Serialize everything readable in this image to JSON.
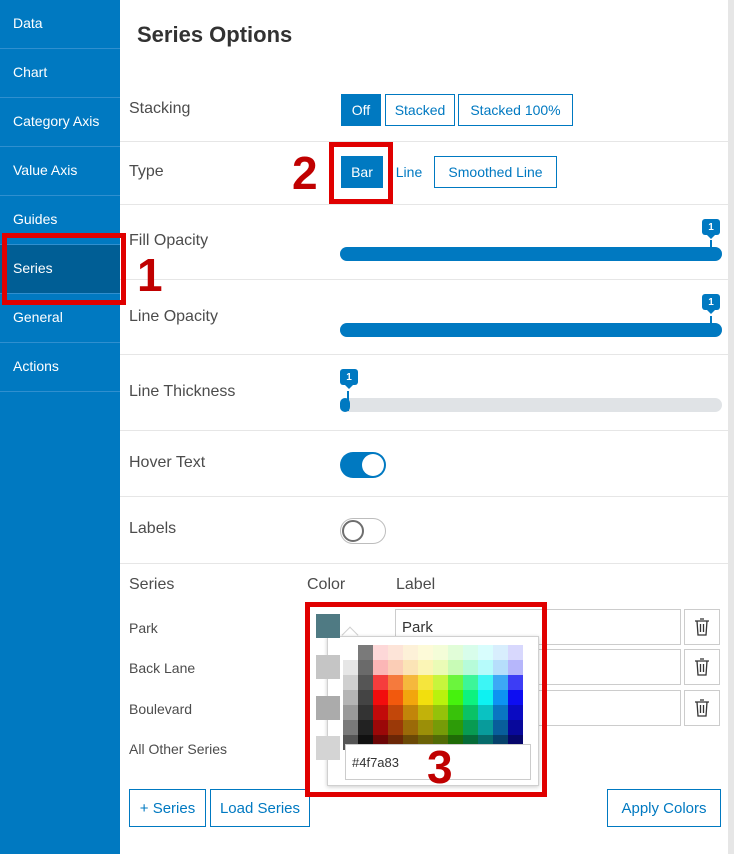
{
  "sidebar": {
    "items": [
      {
        "label": "Data"
      },
      {
        "label": "Chart"
      },
      {
        "label": "Category Axis"
      },
      {
        "label": "Value Axis"
      },
      {
        "label": "Guides"
      },
      {
        "label": "Series"
      },
      {
        "label": "General"
      },
      {
        "label": "Actions"
      }
    ],
    "active": "Series"
  },
  "panel": {
    "title": "Series Options",
    "stacking": {
      "label": "Stacking",
      "options": [
        "Off",
        "Stacked",
        "Stacked 100%"
      ],
      "selected": "Off"
    },
    "type": {
      "label": "Type",
      "options": [
        "Bar",
        "Line",
        "Smoothed Line"
      ],
      "selected": "Bar"
    },
    "fill_opacity": {
      "label": "Fill Opacity",
      "value": "1"
    },
    "line_opacity": {
      "label": "Line Opacity",
      "value": "1"
    },
    "line_thickness": {
      "label": "Line Thickness",
      "value": "1"
    },
    "hover_text": {
      "label": "Hover Text",
      "on": true
    },
    "labels": {
      "label": "Labels",
      "on": false
    }
  },
  "series_table": {
    "headers": {
      "series": "Series",
      "color": "Color",
      "label": "Label"
    },
    "rows": [
      {
        "name": "Park",
        "color": "#4f7a83",
        "label": "Park"
      },
      {
        "name": "Back Lane",
        "color": "#c5c5c5",
        "label": ""
      },
      {
        "name": "Boulevard",
        "color": "#ababab",
        "label": ""
      },
      {
        "name": "All Other Series",
        "color": "#d4d4d4",
        "label": ""
      }
    ]
  },
  "color_picker": {
    "hex_value": "#4f7a83"
  },
  "buttons": {
    "add_series": "+ Series",
    "load_series": "Load Series",
    "apply_colors": "Apply Colors"
  },
  "annotations": [
    "1",
    "2",
    "3"
  ],
  "colors": {
    "accent": "#0079c1",
    "sidebar": "#0079c1",
    "sidebar_active": "#005e95",
    "annotation": "#e00000"
  }
}
